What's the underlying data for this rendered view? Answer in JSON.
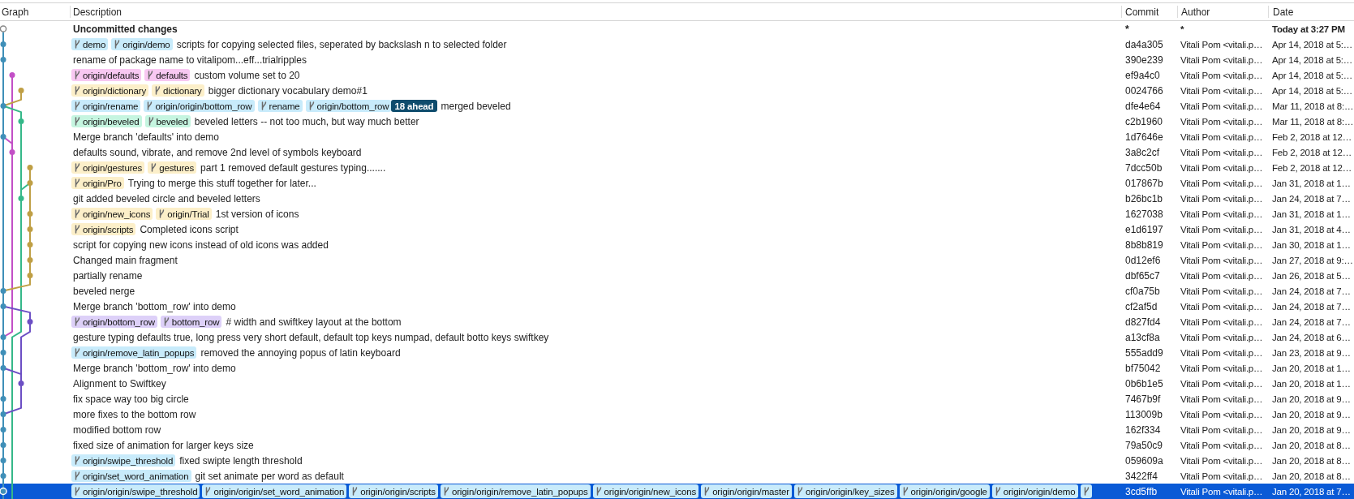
{
  "columns": [
    "Graph",
    "Description",
    "Commit",
    "Author",
    "Date"
  ],
  "rows": [
    {
      "kind": "uncommitted",
      "selected": false,
      "description": "Uncommitted changes",
      "commit": "*",
      "author": "*",
      "date": "Today at 3:27 PM"
    },
    {
      "kind": "commit",
      "selected": false,
      "tags": [
        {
          "kind": "branch",
          "label": "demo",
          "color": "#c8ebfb"
        },
        {
          "kind": "branch",
          "label": "origin/demo",
          "color": "#c8ebfb"
        }
      ],
      "description": "scripts for copying selected files, seperated by backslash n to selected folder",
      "commit": "da4a305",
      "author": "Vitali Pom <vitali.p…",
      "date": "Apr 14, 2018 at 5:…"
    },
    {
      "kind": "commit",
      "selected": false,
      "description": "rename of package name to vitalipom...eff...trialripples",
      "commit": "390e239",
      "author": "Vitali Pom <vitali.p…",
      "date": "Apr 14, 2018 at 5:…"
    },
    {
      "kind": "commit",
      "selected": false,
      "tags": [
        {
          "kind": "branch",
          "label": "origin/defaults",
          "color": "#f8c8f2"
        },
        {
          "kind": "branch",
          "label": "defaults",
          "color": "#f8c8f2"
        }
      ],
      "description": "custom volume set to 20",
      "commit": "ef9a4c0",
      "author": "Vitali Pom <vitali.p…",
      "date": "Apr 14, 2018 at 5:…"
    },
    {
      "kind": "commit",
      "selected": false,
      "tags": [
        {
          "kind": "branch",
          "label": "origin/dictionary",
          "color": "#fcefc9"
        },
        {
          "kind": "branch",
          "label": "dictionary",
          "color": "#fcefc9"
        }
      ],
      "description": "bigger dictionary vocabulary demo#1",
      "commit": "0024766",
      "author": "Vitali Pom <vitali.p…",
      "date": "Apr 14, 2018 at 5:…"
    },
    {
      "kind": "commit",
      "selected": false,
      "tags": [
        {
          "kind": "branch",
          "label": "origin/rename",
          "color": "#c8ebfb"
        },
        {
          "kind": "branch",
          "label": "origin/origin/bottom_row",
          "color": "#c8ebfb"
        },
        {
          "kind": "branch",
          "label": "rename",
          "color": "#c8ebfb"
        },
        {
          "kind": "branch",
          "label": "origin/bottom_row",
          "color": "#c8ebfb"
        },
        {
          "kind": "ahead",
          "label": "18 ahead",
          "color": "#0e4c6d"
        }
      ],
      "description": "merged beveled",
      "commit": "dfe4e64",
      "author": "Vitali Pom <vitali.p…",
      "date": "Mar 11, 2018 at 8:…"
    },
    {
      "kind": "commit",
      "selected": false,
      "tags": [
        {
          "kind": "branch",
          "label": "origin/beveled",
          "color": "#c5f5e0"
        },
        {
          "kind": "branch",
          "label": "beveled",
          "color": "#c5f5e0"
        }
      ],
      "description": "beveled letters -- not too much, but way much better",
      "commit": "c2b1960",
      "author": "Vitali Pom <vitali.p…",
      "date": "Mar 11, 2018 at 8:…"
    },
    {
      "kind": "commit",
      "selected": false,
      "description": "Merge branch 'defaults' into demo",
      "commit": "1d7646e",
      "author": "Vitali Pom <vitali.p…",
      "date": "Feb 2, 2018 at 12…"
    },
    {
      "kind": "commit",
      "selected": false,
      "description": "defaults sound, vibrate, and remove 2nd level of symbols keyboard",
      "commit": "3a8c2cf",
      "author": "Vitali Pom <vitali.p…",
      "date": "Feb 2, 2018 at 12…"
    },
    {
      "kind": "commit",
      "selected": false,
      "tags": [
        {
          "kind": "branch",
          "label": "origin/gestures",
          "color": "#fcefc9"
        },
        {
          "kind": "branch",
          "label": "gestures",
          "color": "#fcefc9"
        }
      ],
      "description": "part 1 removed default gestures typing.......",
      "commit": "7dcc50b",
      "author": "Vitali Pom <vitali.p…",
      "date": "Feb 2, 2018 at 12…"
    },
    {
      "kind": "commit",
      "selected": false,
      "tags": [
        {
          "kind": "branch",
          "label": "origin/Pro",
          "color": "#fcefc9"
        }
      ],
      "description": "Trying to merge this stuff together for later...",
      "commit": "017867b",
      "author": "Vitali Pom <vitali.p…",
      "date": "Jan 31, 2018 at 1…"
    },
    {
      "kind": "commit",
      "selected": false,
      "description": "git added beveled circle and beveled letters",
      "commit": "b26bc1b",
      "author": "Vitali Pom <vitali.p…",
      "date": "Jan 24, 2018 at 7…"
    },
    {
      "kind": "commit",
      "selected": false,
      "tags": [
        {
          "kind": "branch",
          "label": "origin/new_icons",
          "color": "#fcefc9"
        },
        {
          "kind": "branch",
          "label": "origin/Trial",
          "color": "#fcefc9"
        }
      ],
      "description": "1st version of icons",
      "commit": "1627038",
      "author": "Vitali Pom <vitali.p…",
      "date": "Jan 31, 2018 at 1…"
    },
    {
      "kind": "commit",
      "selected": false,
      "tags": [
        {
          "kind": "branch",
          "label": "origin/scripts",
          "color": "#fcefc9"
        }
      ],
      "description": "Completed icons script",
      "commit": "e1d6197",
      "author": "Vitali Pom <vitali.p…",
      "date": "Jan 31, 2018 at 4…"
    },
    {
      "kind": "commit",
      "selected": false,
      "description": "script for copying new icons instead of old icons was added",
      "commit": "8b8b819",
      "author": "Vitali Pom <vitali.p…",
      "date": "Jan 30, 2018 at 1…"
    },
    {
      "kind": "commit",
      "selected": false,
      "description": "Changed main fragment",
      "commit": "0d12ef6",
      "author": "Vitali Pom <vitali.p…",
      "date": "Jan 27, 2018 at 9:…"
    },
    {
      "kind": "commit",
      "selected": false,
      "description": "partially rename",
      "commit": "dbf65c7",
      "author": "Vitali Pom <vitali.p…",
      "date": "Jan 26, 2018 at 5…"
    },
    {
      "kind": "commit",
      "selected": false,
      "description": "beveled nerge",
      "commit": "cf0a75b",
      "author": "Vitali Pom <vitali.p…",
      "date": "Jan 24, 2018 at 7…"
    },
    {
      "kind": "commit",
      "selected": false,
      "description": "Merge branch 'bottom_row' into demo",
      "commit": "cf2af5d",
      "author": "Vitali Pom <vitali.p…",
      "date": "Jan 24, 2018 at 7…"
    },
    {
      "kind": "commit",
      "selected": false,
      "tags": [
        {
          "kind": "branch",
          "label": "origin/bottom_row",
          "color": "#ddd0f8"
        },
        {
          "kind": "branch",
          "label": "bottom_row",
          "color": "#ddd0f8"
        }
      ],
      "description": "# width and swiftkey layout at the bottom",
      "commit": "d827fd4",
      "author": "Vitali Pom <vitali.p…",
      "date": "Jan 24, 2018 at 7…"
    },
    {
      "kind": "commit",
      "selected": false,
      "description": "gesture typing defaults true, long press very short default, default top keys numpad, default botto keys swiftkey",
      "commit": "a13cf8a",
      "author": "Vitali Pom <vitali.p…",
      "date": "Jan 24, 2018 at 6…"
    },
    {
      "kind": "commit",
      "selected": false,
      "tags": [
        {
          "kind": "branch",
          "label": "origin/remove_latin_popups",
          "color": "#c8ebfb"
        }
      ],
      "description": "removed the annoying popus of latin keyboard",
      "commit": "555add9",
      "author": "Vitali Pom <vitali.p…",
      "date": "Jan 23, 2018 at 9…"
    },
    {
      "kind": "commit",
      "selected": false,
      "description": "Merge branch 'bottom_row' into demo",
      "commit": "bf75042",
      "author": "Vitali Pom <vitali.p…",
      "date": "Jan 20, 2018 at 1…"
    },
    {
      "kind": "commit",
      "selected": false,
      "description": "Alignment to Swiftkey",
      "commit": "0b6b1e5",
      "author": "Vitali Pom <vitali.p…",
      "date": "Jan 20, 2018 at 1…"
    },
    {
      "kind": "commit",
      "selected": false,
      "description": "fix space way too big circle",
      "commit": "7467b9f",
      "author": "Vitali Pom <vitali.p…",
      "date": "Jan 20, 2018 at 9…"
    },
    {
      "kind": "commit",
      "selected": false,
      "description": "more fixes to the bottom row",
      "commit": "113009b",
      "author": "Vitali Pom <vitali.p…",
      "date": "Jan 20, 2018 at 9…"
    },
    {
      "kind": "commit",
      "selected": false,
      "description": "modified bottom row",
      "commit": "162f334",
      "author": "Vitali Pom <vitali.p…",
      "date": "Jan 20, 2018 at 9…"
    },
    {
      "kind": "commit",
      "selected": false,
      "description": "fixed size of animation for larger keys size",
      "commit": "79a50c9",
      "author": "Vitali Pom <vitali.p…",
      "date": "Jan 20, 2018 at 8…"
    },
    {
      "kind": "commit",
      "selected": false,
      "tags": [
        {
          "kind": "branch",
          "label": "origin/swipe_threshold",
          "color": "#c8ebfb"
        }
      ],
      "description": "fixed swipte length threshold",
      "commit": "059609a",
      "author": "Vitali Pom <vitali.p…",
      "date": "Jan 20, 2018 at 8…"
    },
    {
      "kind": "commit",
      "selected": false,
      "tags": [
        {
          "kind": "branch",
          "label": "origin/set_word_animation",
          "color": "#c8ebfb"
        }
      ],
      "description": "git set animate per word as default",
      "commit": "3422ff4",
      "author": "Vitali Pom <vitali.p…",
      "date": "Jan 20, 2018 at 8…"
    },
    {
      "kind": "commit",
      "selected": true,
      "tags": [
        {
          "kind": "branch",
          "label": "origin/origin/swipe_threshold",
          "color": "#c8ebfb"
        },
        {
          "kind": "branch",
          "label": "origin/origin/set_word_animation",
          "color": "#c8ebfb"
        },
        {
          "kind": "branch",
          "label": "origin/origin/scripts",
          "color": "#c8ebfb"
        },
        {
          "kind": "branch",
          "label": "origin/origin/remove_latin_popups",
          "color": "#c8ebfb"
        },
        {
          "kind": "branch",
          "label": "origin/origin/new_icons",
          "color": "#c8ebfb"
        },
        {
          "kind": "branch",
          "label": "origin/origin/master",
          "color": "#c8ebfb"
        },
        {
          "kind": "branch",
          "label": "origin/origin/key_sizes",
          "color": "#c8ebfb"
        },
        {
          "kind": "branch",
          "label": "origin/origin/google",
          "color": "#c8ebfb"
        },
        {
          "kind": "branch",
          "label": "origin/origin/demo",
          "color": "#c8ebfb"
        },
        {
          "kind": "branch",
          "color": "#c8ebfb"
        }
      ],
      "commit": "3cd5ffb",
      "author": "Vitali Pom <vitali.p…",
      "date": "Jan 20, 2018 at 7…"
    }
  ]
}
